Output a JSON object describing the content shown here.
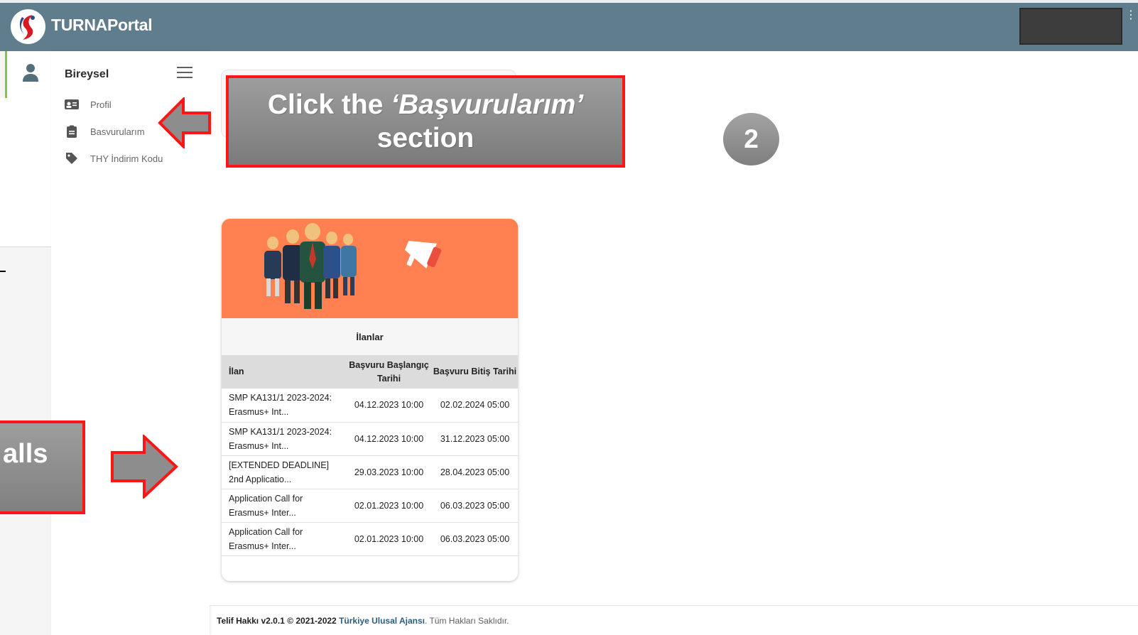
{
  "app": {
    "brand": "TURNAPortal"
  },
  "sidebar": {
    "title": "Bireysel",
    "items": [
      {
        "label": "Profil",
        "icon": "id-card-icon"
      },
      {
        "label": "Basvurularım",
        "icon": "clipboard-icon"
      },
      {
        "label": "THY İndirim Kodu",
        "icon": "tag-icon"
      }
    ]
  },
  "annotations": {
    "callout_prefix": "Click the ",
    "callout_emphasis": "‘Başvurularım’",
    "callout_line2": "section",
    "step_number": "2",
    "left_callout": "alls",
    "colors": {
      "callout_border": "#ff1515",
      "callout_fill": "#8a8a8a"
    }
  },
  "listings": {
    "title": "İlanlar",
    "columns": [
      "İlan",
      "Başvuru Başlangıç Tarihi",
      "Başvuru Bitiş Tarihi"
    ],
    "rows": [
      {
        "title_line1": "SMP KA131/1 2023-2024:",
        "title_line2": "Erasmus+ Int...",
        "start": "04.12.2023 10:00",
        "end": "02.02.2024 05:00"
      },
      {
        "title_line1": "SMP KA131/1 2023-2024:",
        "title_line2": "Erasmus+ Int...",
        "start": "04.12.2023 10:00",
        "end": "31.12.2023 05:00"
      },
      {
        "title_line1": "[EXTENDED DEADLINE]",
        "title_line2": "2nd Applicatio...",
        "start": "29.03.2023 10:00",
        "end": "28.04.2023 05:00"
      },
      {
        "title_line1": "Application Call for",
        "title_line2": "Erasmus+ Inter...",
        "start": "02.01.2023 10:00",
        "end": "06.03.2023 05:00"
      },
      {
        "title_line1": "Application Call for",
        "title_line2": "Erasmus+ Inter...",
        "start": "02.01.2023 10:00",
        "end": "06.03.2023 05:00"
      }
    ]
  },
  "footer": {
    "prefix": "Telif Hakkı v2.0.1 © 2021-2022",
    "link": "Türkiye Ulusal Ajansı",
    "suffix": ". Tüm Hakları Saklıdır."
  },
  "colors": {
    "header": "#5f7d8c",
    "rail_accent": "#8bc34a",
    "banner": "#ff8050"
  }
}
